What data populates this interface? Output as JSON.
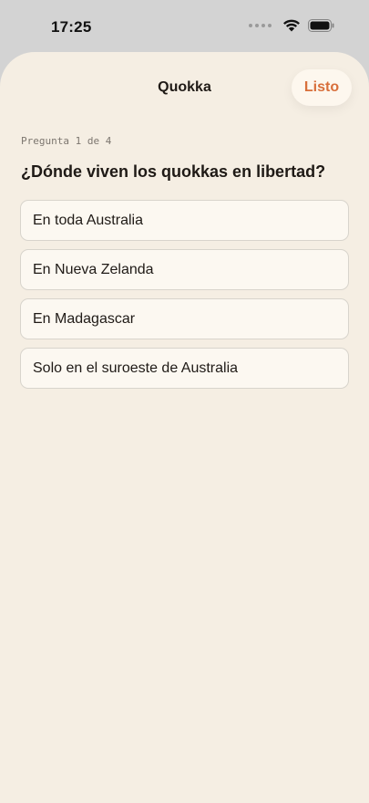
{
  "status_bar": {
    "time": "17:25"
  },
  "header": {
    "title": "Quokka",
    "done_label": "Listo"
  },
  "quiz": {
    "progress": "Pregunta 1 de 4",
    "question": "¿Dónde viven los quokkas en libertad?",
    "options": [
      "En toda Australia",
      "En Nueva Zelanda",
      "En Madagascar",
      "Solo en el suroeste de Australia"
    ]
  },
  "colors": {
    "accent": "#d86f3b",
    "sheet_background": "#f5eee3"
  }
}
